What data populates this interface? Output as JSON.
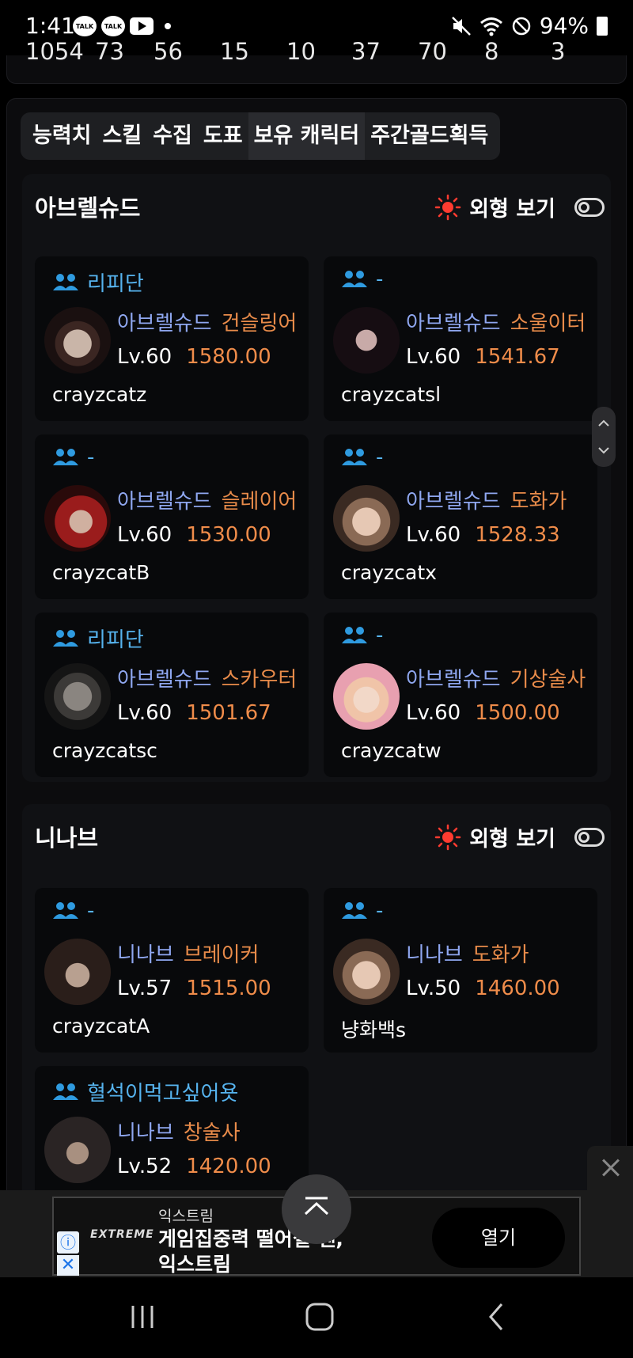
{
  "status_bar": {
    "time": "1:41",
    "talk_badge": "TALK",
    "battery": "94%"
  },
  "stats_row": [
    "1054",
    "73",
    "56",
    "15",
    "10",
    "37",
    "70",
    "8",
    "3"
  ],
  "tabs": [
    {
      "label": "능력치",
      "active": false
    },
    {
      "label": "스킬",
      "active": false
    },
    {
      "label": "수집",
      "active": false
    },
    {
      "label": "도표",
      "active": false
    },
    {
      "label": "보유 캐릭터",
      "active": true
    },
    {
      "label": "주간골드획득",
      "active": false
    }
  ],
  "appearance_label": "외형 보기",
  "sections": [
    {
      "server": "아브렐슈드",
      "characters": [
        {
          "guild": "리피단",
          "server": "아브렐슈드",
          "class": "건슬링어",
          "level": "Lv.60",
          "item_level": "1580.00",
          "name": "crayzcatz"
        },
        {
          "guild": "-",
          "server": "아브렐슈드",
          "class": "소울이터",
          "level": "Lv.60",
          "item_level": "1541.67",
          "name": "crayzcatsl"
        },
        {
          "guild": "-",
          "server": "아브렐슈드",
          "class": "슬레이어",
          "level": "Lv.60",
          "item_level": "1530.00",
          "name": "crayzcatB"
        },
        {
          "guild": "-",
          "server": "아브렐슈드",
          "class": "도화가",
          "level": "Lv.60",
          "item_level": "1528.33",
          "name": "crayzcatx"
        },
        {
          "guild": "리피단",
          "server": "아브렐슈드",
          "class": "스카우터",
          "level": "Lv.60",
          "item_level": "1501.67",
          "name": "crayzcatsc"
        },
        {
          "guild": "-",
          "server": "아브렐슈드",
          "class": "기상술사",
          "level": "Lv.60",
          "item_level": "1500.00",
          "name": "crayzcatw"
        }
      ]
    },
    {
      "server": "니나브",
      "characters": [
        {
          "guild": "-",
          "server": "니나브",
          "class": "브레이커",
          "level": "Lv.57",
          "item_level": "1515.00",
          "name": "crayzcatA"
        },
        {
          "guild": "-",
          "server": "니나브",
          "class": "도화가",
          "level": "Lv.50",
          "item_level": "1460.00",
          "name": "냥화백s"
        },
        {
          "guild": "혈석이먹고싶어욧",
          "server": "니나브",
          "class": "창술사",
          "level": "Lv.52",
          "item_level": "1420.00",
          "name": ""
        }
      ]
    }
  ],
  "ad": {
    "logo": "EXTREME",
    "brand": "익스트림",
    "headline_line1": "게임집중력 떨어질 땐,",
    "headline_line2": "익스트림",
    "open_label": "열기",
    "info_glyph": "ⓘ",
    "close_glyph": "✕"
  },
  "colors": {
    "guild": "#56b3ee",
    "server_name": "#8fa7f0",
    "class_name": "#e88b4a",
    "item_level": "#ef8c4a",
    "sun_icon": "#ff3b30"
  }
}
